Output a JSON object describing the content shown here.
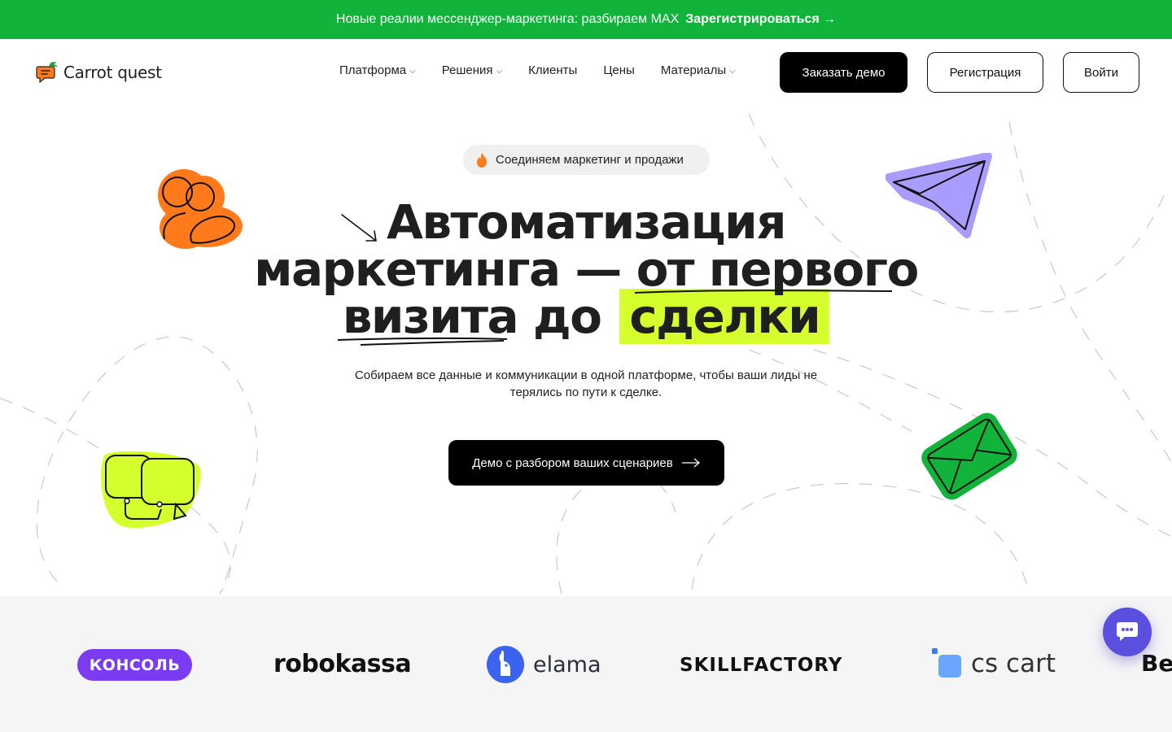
{
  "banner": {
    "text": "Новые реалии мессенджер-маркетинга: разбираем MAX",
    "cta": "Зарегистрироваться →"
  },
  "header": {
    "logo_text": "Carrot quest",
    "nav": [
      {
        "label": "Платформа",
        "dropdown": true
      },
      {
        "label": "Решения",
        "dropdown": true
      },
      {
        "label": "Клиенты",
        "dropdown": false
      },
      {
        "label": "Цены",
        "dropdown": false
      },
      {
        "label": "Материалы",
        "dropdown": true
      }
    ],
    "demo_button": "Заказать демо",
    "register_button": "Регистрация",
    "login_button": "Войти"
  },
  "hero": {
    "pill": "Соединяем маркетинг и продажи",
    "title_line1": "Автоматизация",
    "title_line2a": "маркетинга —",
    "title_line2b": "от первого",
    "title_line3a": "визита",
    "title_line3b": "до",
    "title_line3c": "сделки",
    "subtitle": "Собираем все данные и коммуникации в одной платформе, чтобы ваши лиды не терялись по пути к сделке.",
    "cta": "Демо с разбором ваших сценариев"
  },
  "clients": [
    {
      "name": "КОНСОЛЬ"
    },
    {
      "name": "robokassa"
    },
    {
      "name": "elama"
    },
    {
      "name": "SKILLFACTORY"
    },
    {
      "name": "cs cart"
    },
    {
      "name": "Be"
    }
  ],
  "colors": {
    "banner_green": "#12b33a",
    "highlight_lime": "#d6ff2e",
    "chat_purple": "#5b4fe0",
    "konsol_purple": "#7b3bf0"
  },
  "icons": {
    "users_sticker": "users-icon",
    "paper_plane_sticker": "paper-plane-icon",
    "chat_bubbles_sticker": "chat-bubbles-icon",
    "envelope_sticker": "envelope-icon",
    "fire": "fire-icon",
    "chat_fab": "chat-icon"
  }
}
